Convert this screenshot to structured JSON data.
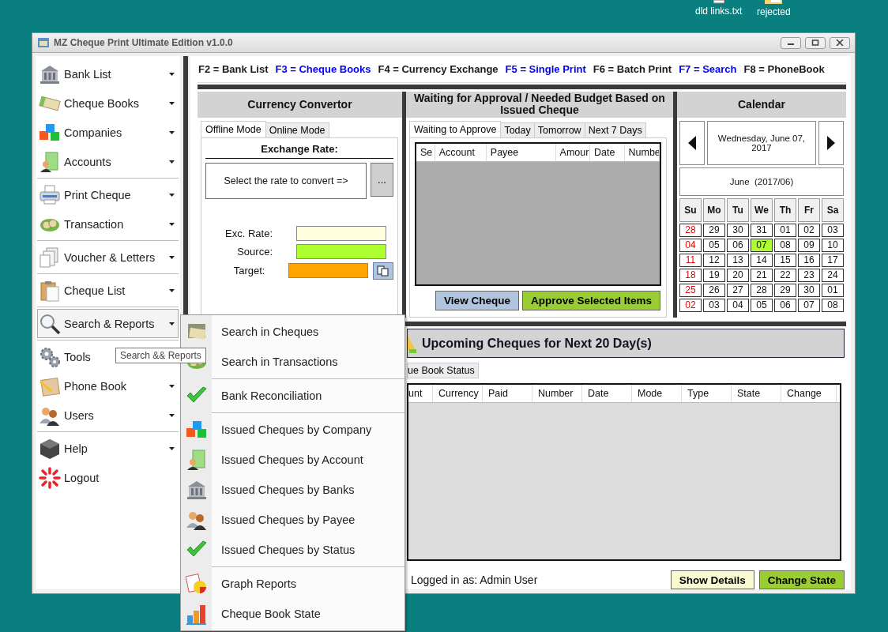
{
  "desktop_icons": [
    {
      "label": "dld links.txt"
    },
    {
      "label": "rejected"
    }
  ],
  "window": {
    "title": "MZ Cheque Print Ultimate Edition v1.0.0"
  },
  "sidebar": {
    "groups": [
      {
        "items": [
          {
            "label": "Bank List",
            "has_menu": true,
            "selected": false
          },
          {
            "label": "Cheque Books",
            "has_menu": true,
            "selected": false
          },
          {
            "label": "Companies",
            "has_menu": true,
            "selected": false
          },
          {
            "label": "Accounts",
            "has_menu": true,
            "selected": false
          }
        ]
      },
      {
        "items": [
          {
            "label": "Print Cheque",
            "has_menu": true,
            "selected": false
          },
          {
            "label": "Transaction",
            "has_menu": true,
            "selected": false
          }
        ]
      },
      {
        "items": [
          {
            "label": "Voucher & Letters",
            "has_menu": true,
            "selected": false
          }
        ]
      },
      {
        "items": [
          {
            "label": "Cheque List",
            "has_menu": true,
            "selected": false
          }
        ]
      },
      {
        "items": [
          {
            "label": "Search & Reports",
            "has_menu": true,
            "selected": true
          }
        ]
      },
      {
        "items": [
          {
            "label": "Tools",
            "selected": false
          },
          {
            "label": "Phone Book",
            "has_menu": true,
            "selected": false
          },
          {
            "label": "Users",
            "has_menu": true,
            "selected": false
          }
        ]
      },
      {
        "items": [
          {
            "label": "Help",
            "has_menu": true,
            "selected": false
          },
          {
            "label": "Logout",
            "has_menu": false,
            "selected": false
          }
        ]
      }
    ]
  },
  "shortcuts": [
    {
      "text": "F2 = Bank List",
      "color": "#1a1a1a"
    },
    {
      "text": "F3 = Cheque Books",
      "color": "#0000ff"
    },
    {
      "text": "F4 = Currency Exchange",
      "color": "#1a1a1a"
    },
    {
      "text": "F5 = Single Print",
      "color": "#0000ff"
    },
    {
      "text": "F6 = Batch Print",
      "color": "#1a1a1a"
    },
    {
      "text": "F7 = Search",
      "color": "#0000ff"
    },
    {
      "text": "F8 = PhoneBook",
      "color": "#1a1a1a"
    }
  ],
  "currency_convertor": {
    "title": "Currency Convertor",
    "tabs": [
      {
        "label": "Offline Mode",
        "selected": true
      },
      {
        "label": "Online Mode",
        "selected": false
      }
    ],
    "heading": "Exchange Rate:",
    "rate_selector": "Select the rate to convert =>",
    "browse_button": "...",
    "fields": [
      {
        "label": "Exc. Rate:",
        "color": "#ffffe0"
      },
      {
        "label": "Source:",
        "color": "#adff2f"
      },
      {
        "label": "Target:",
        "color": "#ffa500"
      }
    ]
  },
  "approval": {
    "title": "Waiting for Approval / Needed Budget Based on Issued Cheque",
    "tabs": [
      {
        "label": "Waiting to Approve",
        "selected": true
      },
      {
        "label": "Today",
        "selected": false
      },
      {
        "label": "Tomorrow",
        "selected": false
      },
      {
        "label": "Next 7 Days",
        "selected": false
      }
    ],
    "columns": [
      "Se",
      "Account",
      "Payee",
      "Amour",
      "Date",
      "Numbe"
    ],
    "buttons": [
      {
        "label": "View Cheque",
        "color": "#b0c4de"
      },
      {
        "label": "Approve Selected Items",
        "color": "#9acd32"
      }
    ]
  },
  "calendar": {
    "title": "Calendar",
    "date": "Wednesday, June 07, 2017",
    "month": "June  (2017/06)",
    "weekdays": [
      "Su",
      "Mo",
      "Tu",
      "We",
      "Th",
      "Fr",
      "Sa"
    ],
    "weeks": [
      [
        {
          "day": "28",
          "selected": false
        },
        {
          "day": "29",
          "selected": false
        },
        {
          "day": "30",
          "selected": false
        },
        {
          "day": "31",
          "selected": false
        },
        {
          "day": "01",
          "selected": false
        },
        {
          "day": "02",
          "selected": false
        },
        {
          "day": "03",
          "selected": false
        }
      ],
      [
        {
          "day": "04",
          "selected": false
        },
        {
          "day": "05",
          "selected": false
        },
        {
          "day": "06",
          "selected": false
        },
        {
          "day": "07",
          "selected": true
        },
        {
          "day": "08",
          "selected": false
        },
        {
          "day": "09",
          "selected": false
        },
        {
          "day": "10",
          "selected": false
        }
      ],
      [
        {
          "day": "11",
          "selected": false
        },
        {
          "day": "12",
          "selected": false
        },
        {
          "day": "13",
          "selected": false
        },
        {
          "day": "14",
          "selected": false
        },
        {
          "day": "15",
          "selected": false
        },
        {
          "day": "16",
          "selected": false
        },
        {
          "day": "17",
          "selected": false
        }
      ],
      [
        {
          "day": "18",
          "selected": false
        },
        {
          "day": "19",
          "selected": false
        },
        {
          "day": "20",
          "selected": false
        },
        {
          "day": "21",
          "selected": false
        },
        {
          "day": "22",
          "selected": false
        },
        {
          "day": "23",
          "selected": false
        },
        {
          "day": "24",
          "selected": false
        }
      ],
      [
        {
          "day": "25",
          "selected": false
        },
        {
          "day": "26",
          "selected": false
        },
        {
          "day": "27",
          "selected": false
        },
        {
          "day": "28",
          "selected": false
        },
        {
          "day": "29",
          "selected": false
        },
        {
          "day": "30",
          "selected": false
        },
        {
          "day": "01",
          "selected": false
        }
      ],
      [
        {
          "day": "02",
          "selected": false
        },
        {
          "day": "03",
          "selected": false
        },
        {
          "day": "04",
          "selected": false
        },
        {
          "day": "05",
          "selected": false
        },
        {
          "day": "06",
          "selected": false
        },
        {
          "day": "07",
          "selected": false
        },
        {
          "day": "08",
          "selected": false
        }
      ]
    ]
  },
  "upcoming": {
    "title": "Upcoming Cheques for Next 20 Day(s)",
    "tabs": [
      {
        "label": "ue Book Status",
        "selected": false
      }
    ],
    "columns": [
      "unt",
      "Currency",
      "Paid",
      "Number",
      "Date",
      "Mode",
      "Type",
      "State",
      "Change"
    ]
  },
  "status": {
    "user": "Logged in as: Admin User",
    "buttons": [
      {
        "label": "Show Details",
        "color": "#fafad2"
      },
      {
        "label": "Change State",
        "color": "#9acd32"
      }
    ]
  },
  "menu": {
    "sections": [
      {
        "items": [
          {
            "label": "Search in Cheques"
          },
          {
            "label": "Search in Transactions"
          }
        ]
      },
      {
        "items": [
          {
            "label": "Bank Reconciliation"
          }
        ]
      },
      {
        "items": [
          {
            "label": "Issued Cheques by Company"
          },
          {
            "label": "Issued Cheques by Account"
          },
          {
            "label": "Issued Cheques by Banks"
          },
          {
            "label": "Issued Cheques by Payee"
          },
          {
            "label": "Issued Cheques by Status"
          }
        ]
      },
      {
        "items": [
          {
            "label": "Graph Reports"
          },
          {
            "label": "Cheque Book State"
          }
        ]
      }
    ]
  },
  "tooltip": "Search && Reports"
}
